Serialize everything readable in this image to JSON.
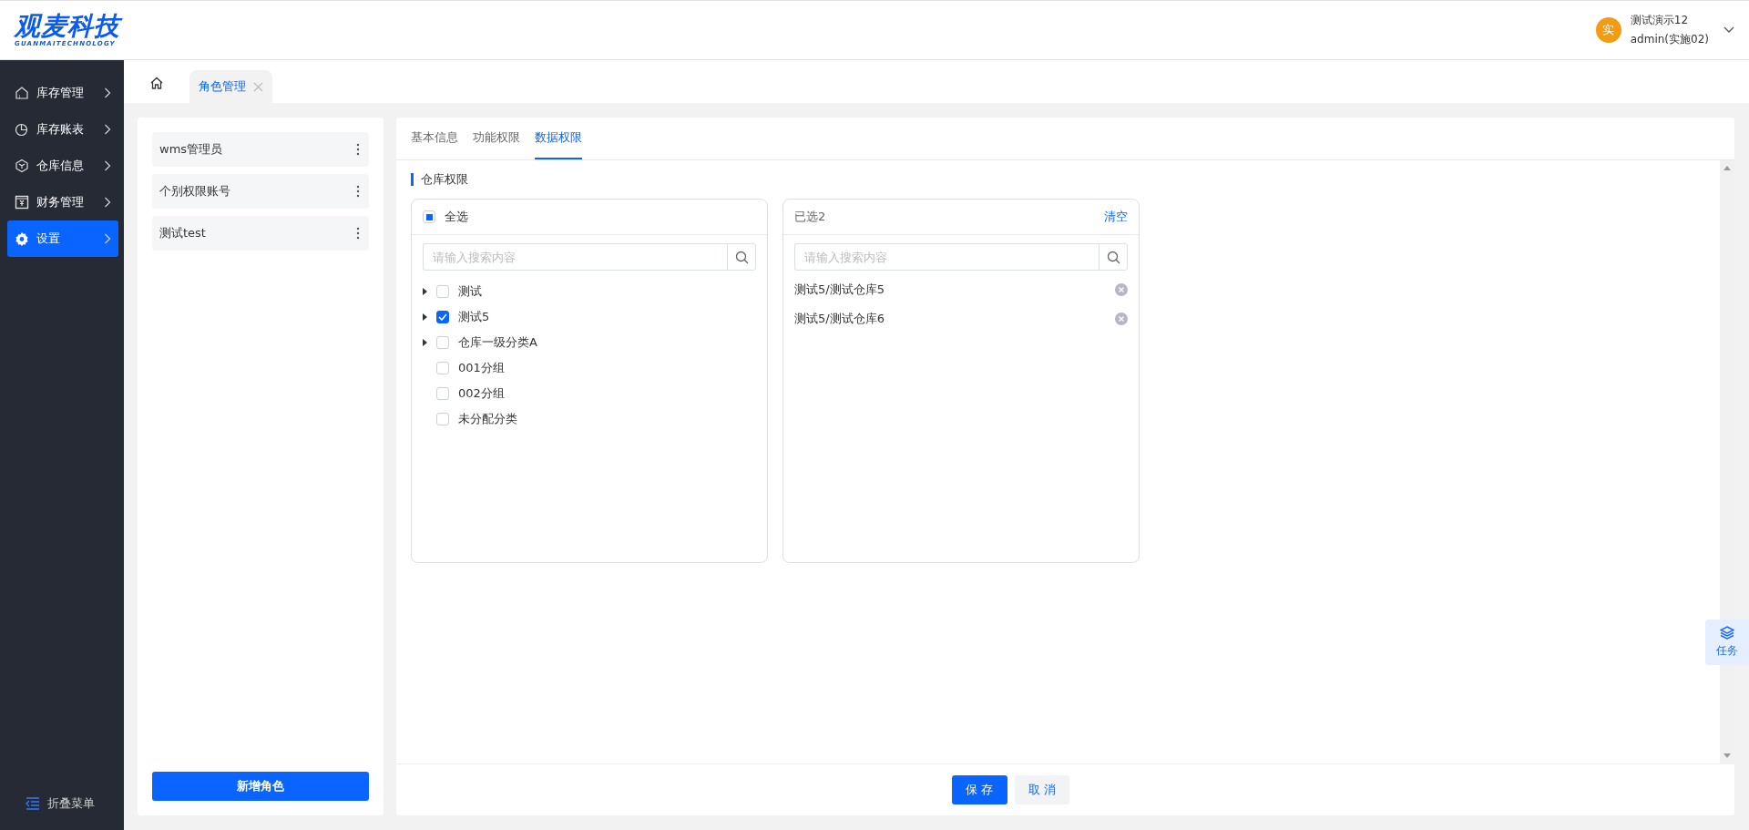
{
  "header": {
    "logo": "观麦科技",
    "logo_sub": "GUANMAITECHNOLOGY",
    "user": {
      "avatar": "实",
      "name": "测试演示12",
      "account": "admin(实施02)"
    }
  },
  "sidebar": {
    "items": [
      {
        "label": "库存管理",
        "kind": "house",
        "selected": false
      },
      {
        "label": "库存账表",
        "kind": "pie",
        "selected": false
      },
      {
        "label": "仓库信息",
        "kind": "box",
        "selected": false
      },
      {
        "label": "财务管理",
        "kind": "money",
        "selected": false
      },
      {
        "label": "设置",
        "kind": "gear",
        "selected": true
      }
    ],
    "collapse": "折叠菜单"
  },
  "page_tabs": [
    {
      "label": "角色管理",
      "selected": true
    }
  ],
  "roles": {
    "items": [
      {
        "label": "wms管理员"
      },
      {
        "label": "个别权限账号"
      },
      {
        "label": "测试test"
      }
    ],
    "add_button": "新增角色"
  },
  "detail_tabs": [
    {
      "label": "基本信息",
      "selected": false
    },
    {
      "label": "功能权限",
      "selected": false
    },
    {
      "label": "数据权限",
      "selected": true
    }
  ],
  "section_title": "仓库权限",
  "source": {
    "select_all": {
      "label": "全选",
      "indeterminate": true
    },
    "search": {
      "placeholder": "请输入搜索内容"
    },
    "tree": [
      {
        "label": "测试",
        "expandable": true,
        "checked": false
      },
      {
        "label": "测试5",
        "expandable": true,
        "checked": true
      },
      {
        "label": "仓库一级分类A",
        "expandable": true,
        "checked": false
      },
      {
        "label": "001分组",
        "expandable": false,
        "checked": false
      },
      {
        "label": "002分组",
        "expandable": false,
        "checked": false
      },
      {
        "label": "未分配分类",
        "expandable": false,
        "checked": false
      }
    ]
  },
  "target": {
    "title": "已选2",
    "clear": "清空",
    "search": {
      "placeholder": "请输入搜索内容"
    },
    "items": [
      {
        "label": "测试5/测试仓库5"
      },
      {
        "label": "测试5/测试仓库6"
      }
    ]
  },
  "footer": {
    "save": "保 存",
    "cancel": "取 消"
  },
  "task_button": "任务"
}
